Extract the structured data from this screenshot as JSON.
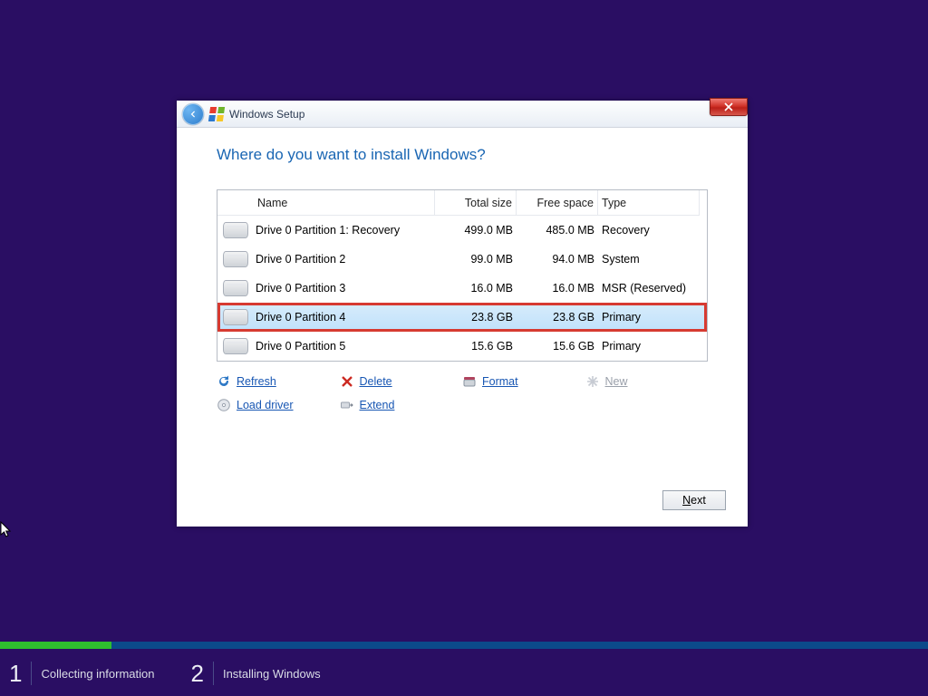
{
  "titlebar": {
    "title": "Windows Setup"
  },
  "heading": "Where do you want to install Windows?",
  "columns": {
    "name": "Name",
    "total": "Total size",
    "free": "Free space",
    "type": "Type"
  },
  "partitions": [
    {
      "name": "Drive 0 Partition 1: Recovery",
      "total": "499.0 MB",
      "free": "485.0 MB",
      "type": "Recovery",
      "selected": false,
      "highlight": false
    },
    {
      "name": "Drive 0 Partition 2",
      "total": "99.0 MB",
      "free": "94.0 MB",
      "type": "System",
      "selected": false,
      "highlight": false
    },
    {
      "name": "Drive 0 Partition 3",
      "total": "16.0 MB",
      "free": "16.0 MB",
      "type": "MSR (Reserved)",
      "selected": false,
      "highlight": false
    },
    {
      "name": "Drive 0 Partition 4",
      "total": "23.8 GB",
      "free": "23.8 GB",
      "type": "Primary",
      "selected": true,
      "highlight": true
    },
    {
      "name": "Drive 0 Partition 5",
      "total": "15.6 GB",
      "free": "15.6 GB",
      "type": "Primary",
      "selected": false,
      "highlight": false
    }
  ],
  "actions": {
    "refresh": {
      "label": "Refresh",
      "enabled": true
    },
    "delete": {
      "label": "Delete",
      "enabled": true
    },
    "format": {
      "label": "Format",
      "enabled": true
    },
    "new": {
      "label": "New",
      "enabled": false
    },
    "load": {
      "label": "Load driver",
      "enabled": true
    },
    "extend": {
      "label": "Extend",
      "enabled": true
    }
  },
  "next_button": {
    "prefix": "N",
    "rest": "ext"
  },
  "steps": {
    "s1": {
      "num": "1",
      "label": "Collecting information"
    },
    "s2": {
      "num": "2",
      "label": "Installing Windows"
    }
  }
}
